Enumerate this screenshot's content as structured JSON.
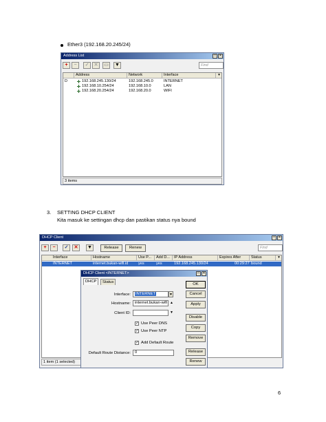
{
  "doc": {
    "bullet_text": "Ether3 (192.168.20.245/24)",
    "section_number": "3.",
    "section_title": "SETTING DHCP CLIENT",
    "section_body": "Kita masuk ke settingan dhcp dan pastikan status nya bound",
    "page_number": "6"
  },
  "address_list": {
    "title": "Address List",
    "find_placeholder": "Find",
    "columns": [
      "Address",
      "Network",
      "Interface"
    ],
    "rows": [
      {
        "flag": "D",
        "address": "192.168.245.130/24",
        "network": "192.168.245.0",
        "interface": "INTERNET"
      },
      {
        "flag": "",
        "address": "192.168.10.254/24",
        "network": "192.168.10.0",
        "interface": "LAN"
      },
      {
        "flag": "",
        "address": "192.168.20.254/24",
        "network": "192.168.20.0",
        "interface": "WIFI"
      }
    ],
    "status": "3 items"
  },
  "dhcp_client": {
    "title": "DHCP Client",
    "release_label": "Release",
    "renew_label": "Renew",
    "find_placeholder": "Find",
    "columns": [
      "Interface",
      "Hostname",
      "Use P...",
      "Add D...",
      "IP Address",
      "Expires After",
      "Status"
    ],
    "row": {
      "interface": "INTERNET",
      "hostname": "internet.bukan-wifi.id",
      "use_peer": "yes",
      "add_default": "yes",
      "ip_address": "192.168.245.130/24",
      "expires_after": "00:29:27",
      "status": "bound"
    },
    "status": "1 item (1 selected)"
  },
  "dhcp_dialog": {
    "title": "DHCP Client <INTERNET>",
    "tabs": [
      "DHCP",
      "Status"
    ],
    "interface_label": "Interface:",
    "interface_value": "INTERNET",
    "hostname_label": "Hostname:",
    "hostname_value": "internet.bukan-wifi",
    "client_id_label": "Client ID:",
    "client_id_value": "",
    "use_peer_dns": "Use Peer DNS",
    "use_peer_ntp": "Use Peer NTP",
    "add_default_route": "Add Default Route",
    "default_route_distance_label": "Default Route Distance:",
    "default_route_distance_value": "0",
    "buttons": [
      "OK",
      "Cancel",
      "Apply",
      "Disable",
      "Copy",
      "Remove",
      "Release",
      "Renew"
    ]
  },
  "icons": {
    "add": "plus-icon",
    "remove": "minus-icon",
    "enable": "check-icon",
    "disable": "x-icon",
    "comment": "comment-icon",
    "filter": "filter-icon"
  }
}
